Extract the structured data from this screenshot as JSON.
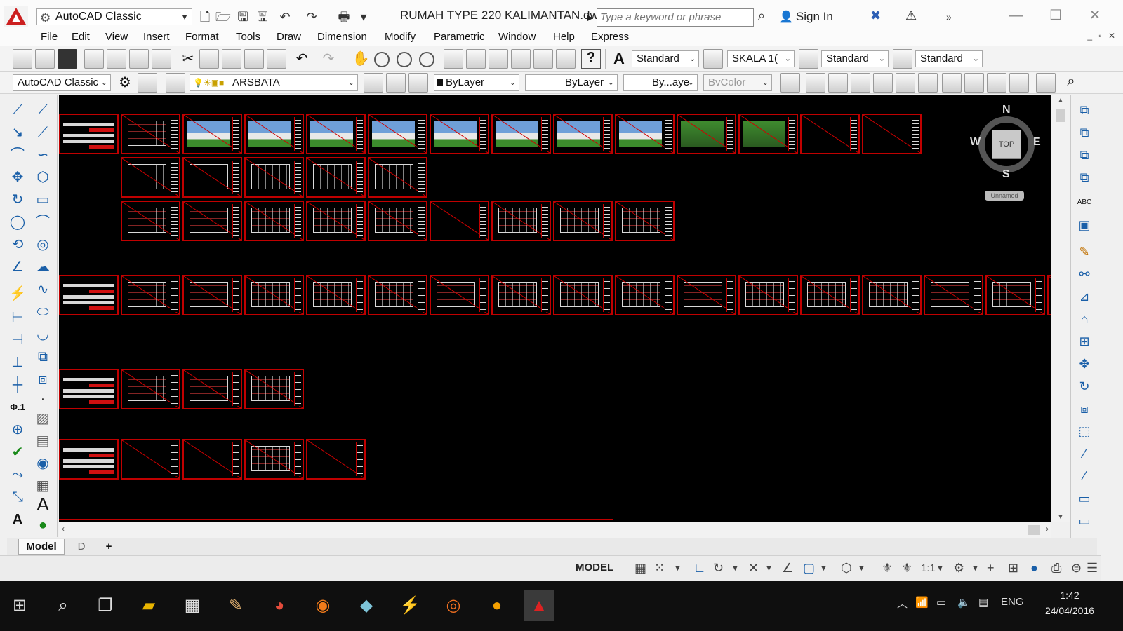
{
  "titlebar": {
    "workspace": "AutoCAD Classic",
    "document": "RUMAH TYPE 220 KALIMANTAN.dwg",
    "search_placeholder": "Type a keyword or phrase",
    "sign_in": "Sign In"
  },
  "menu": [
    "File",
    "Edit",
    "View",
    "Insert",
    "Format",
    "Tools",
    "Draw",
    "Dimension",
    "Modify",
    "Parametric",
    "Window",
    "Help",
    "Express"
  ],
  "toolbar1": {
    "text_style": "Standard",
    "dim_style": "SKALA 1(",
    "table_style": "Standard",
    "multileader_style": "Standard"
  },
  "toolbar2": {
    "workspace": "AutoCAD Classic",
    "layer": "ARSBATA",
    "color": "ByLayer",
    "linetype": "ByLayer",
    "lineweight": "By...aye",
    "plotstyle": "BvColor"
  },
  "viewcube": {
    "n": "N",
    "s": "S",
    "e": "E",
    "w": "W",
    "top": "TOP",
    "ucs": "Unnamed"
  },
  "tabs": {
    "model": "Model",
    "layout": "D",
    "add": "+"
  },
  "statusbar": {
    "mode": "MODEL",
    "scale": "1:1"
  },
  "taskbar": {
    "language": "ENG",
    "time": "1:42",
    "date": "24/04/2016"
  }
}
